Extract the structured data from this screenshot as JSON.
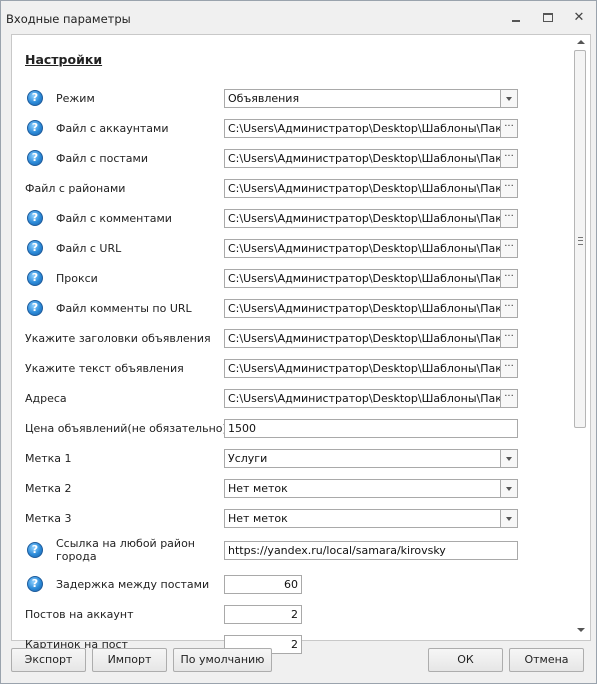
{
  "window": {
    "title": "Входные параметры"
  },
  "section": {
    "title": "Настройки"
  },
  "fields": [
    {
      "label": "Режим",
      "value": "Объявления",
      "help": true,
      "kind": "dropdown"
    },
    {
      "label": "Файл с аккаунтами",
      "value": "C:\\Users\\Администратор\\Desktop\\Шаблоны\\Пакет ян",
      "help": true,
      "kind": "file"
    },
    {
      "label": "Файл с постами",
      "value": "C:\\Users\\Администратор\\Desktop\\Шаблоны\\Пакет ян",
      "help": true,
      "kind": "file"
    },
    {
      "label": "Файл с районами",
      "value": "C:\\Users\\Администратор\\Desktop\\Шаблоны\\Пакет ян",
      "help": false,
      "kind": "file"
    },
    {
      "label": "Файл с комментами",
      "value": "C:\\Users\\Администратор\\Desktop\\Шаблоны\\Пакет ян",
      "help": true,
      "kind": "file"
    },
    {
      "label": "Файл с URL",
      "value": "C:\\Users\\Администратор\\Desktop\\Шаблоны\\Пакет ян",
      "help": true,
      "kind": "file"
    },
    {
      "label": "Прокси",
      "value": "C:\\Users\\Администратор\\Desktop\\Шаблоны\\Пакет ян",
      "help": true,
      "kind": "file"
    },
    {
      "label": "Файл комменты по URL",
      "value": "C:\\Users\\Администратор\\Desktop\\Шаблоны\\Пакет ян",
      "help": true,
      "kind": "file"
    },
    {
      "label": "Укажите заголовки объявления",
      "value": "C:\\Users\\Администратор\\Desktop\\Шаблоны\\Пакет ян",
      "help": false,
      "kind": "file"
    },
    {
      "label": "Укажите текст объявления",
      "value": "C:\\Users\\Администратор\\Desktop\\Шаблоны\\Пакет ян",
      "help": false,
      "kind": "file"
    },
    {
      "label": "Адреса",
      "value": "C:\\Users\\Администратор\\Desktop\\Шаблоны\\Пакет ян",
      "help": false,
      "kind": "file"
    },
    {
      "label": "Цена объявлений(не обязательно)",
      "value": "1500",
      "help": false,
      "kind": "text"
    },
    {
      "label": "Метка 1",
      "value": "Услуги",
      "help": false,
      "kind": "dropdown"
    },
    {
      "label": "Метка 2",
      "value": "Нет меток",
      "help": false,
      "kind": "dropdown"
    },
    {
      "label": "Метка 3",
      "value": "Нет меток",
      "help": false,
      "kind": "dropdown"
    },
    {
      "label": "Ссылка на любой район города",
      "value": "https://yandex.ru/local/samara/kirovsky",
      "help": true,
      "kind": "text"
    },
    {
      "label": "Задержка между постами",
      "value": "60",
      "help": true,
      "kind": "number"
    },
    {
      "label": "Постов на аккаунт",
      "value": "2",
      "help": false,
      "kind": "number"
    },
    {
      "label": "Картинок на пост",
      "value": "2",
      "help": false,
      "kind": "number"
    }
  ],
  "icons": {
    "help": "help-question-icon",
    "browse": "ellipsis-icon",
    "dropdown": "chevron-down-icon"
  },
  "browse_glyph": "···",
  "help_glyph": "?",
  "footer": {
    "export": "Экспорт",
    "import": "Импорт",
    "defaults": "По умолчанию",
    "ok": "ОК",
    "cancel": "Отмена"
  }
}
